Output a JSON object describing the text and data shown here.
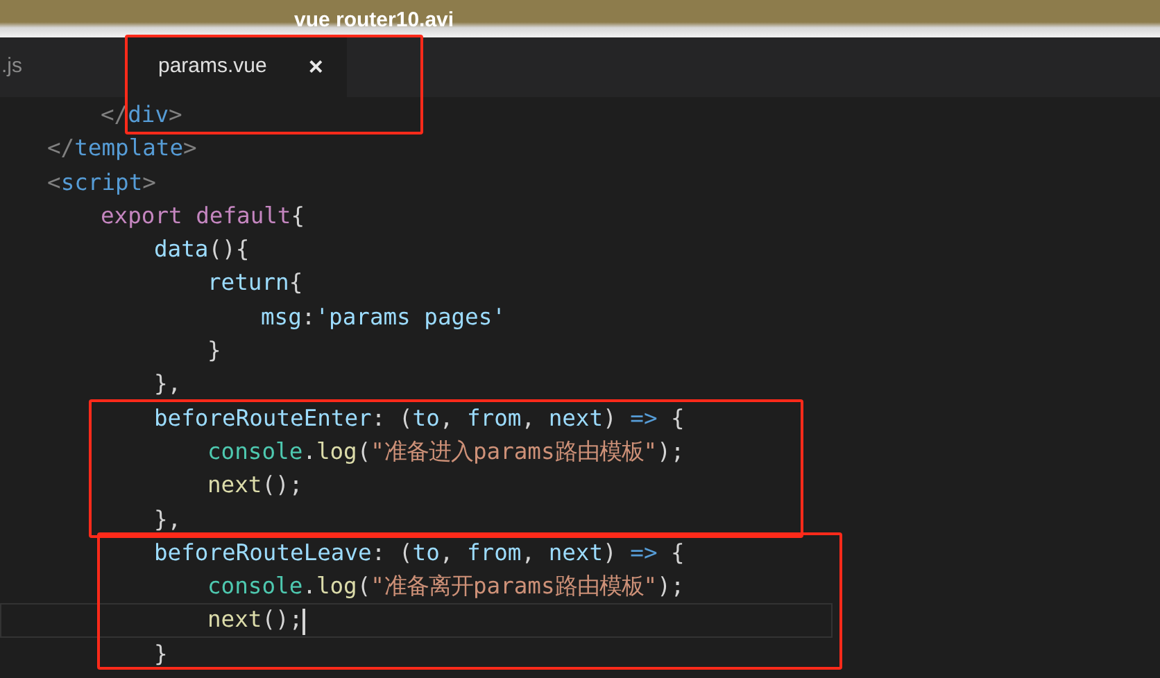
{
  "video_title": "vue router10.avi",
  "tabs": [
    {
      "label": ".js",
      "selected": false
    },
    {
      "label": "params.vue",
      "selected": true,
      "close": "×"
    }
  ],
  "code_lines": [
    {
      "children": [
        {
          "current": false,
          "tokens": [
            {
              "kind": "bracket",
              "text": "</"
            },
            {
              "kind": "tag",
              "text": "div"
            },
            {
              "kind": "bracket",
              "text": ">"
            }
          ]
        }
      ]
    },
    {
      "current": false,
      "tokens": [
        {
          "kind": "bracket",
          "text": "</"
        },
        {
          "kind": "tag",
          "text": "template"
        },
        {
          "kind": "bracket",
          "text": ">"
        }
      ]
    },
    {
      "current": false,
      "tokens": [
        {
          "kind": "bracket",
          "text": "<"
        },
        {
          "kind": "tag",
          "text": "script"
        },
        {
          "kind": "bracket",
          "text": ">"
        }
      ],
      "children": [
        {
          "current": false,
          "tokens": [
            {
              "kind": "keyword",
              "text": "export default"
            },
            {
              "kind": "punct",
              "text": "{"
            }
          ],
          "children": [
            {
              "current": false,
              "tokens": [
                {
                  "kind": "property",
                  "text": "data"
                },
                {
                  "kind": "punct",
                  "text": "(){"
                }
              ],
              "children": [
                {
                  "current": false,
                  "tokens": [
                    {
                      "kind": "property",
                      "text": "return"
                    },
                    {
                      "kind": "punct",
                      "text": "{"
                    }
                  ],
                  "children": [
                    {
                      "current": false,
                      "tokens": [
                        {
                          "kind": "property",
                          "text": "msg"
                        },
                        {
                          "kind": "punct",
                          "text": ":"
                        },
                        {
                          "kind": "property",
                          "text": "'params pages'"
                        }
                      ]
                    }
                  ]
                },
                {
                  "current": false,
                  "tokens": [
                    {
                      "kind": "punct",
                      "text": "}"
                    }
                  ]
                }
              ]
            },
            {
              "current": false,
              "tokens": [
                {
                  "kind": "punct",
                  "text": "},"
                }
              ]
            },
            {
              "current": false,
              "tokens": [
                {
                  "kind": "property",
                  "text": "beforeRouteEnter"
                },
                {
                  "kind": "punct",
                  "text": ": ("
                },
                {
                  "kind": "property",
                  "text": "to"
                },
                {
                  "kind": "punct",
                  "text": ", "
                },
                {
                  "kind": "property",
                  "text": "from"
                },
                {
                  "kind": "punct",
                  "text": ", "
                },
                {
                  "kind": "property",
                  "text": "next"
                },
                {
                  "kind": "punct",
                  "text": ") "
                },
                {
                  "kind": "arrow",
                  "text": "=>"
                },
                {
                  "kind": "punct",
                  "text": " {"
                }
              ],
              "children": [
                {
                  "current": false,
                  "tokens": [
                    {
                      "kind": "class",
                      "text": "console"
                    },
                    {
                      "kind": "punct",
                      "text": "."
                    },
                    {
                      "kind": "func",
                      "text": "log"
                    },
                    {
                      "kind": "punct",
                      "text": "("
                    },
                    {
                      "kind": "string",
                      "text": "\"准备进入params路由模板\""
                    },
                    {
                      "kind": "punct",
                      "text": ");"
                    }
                  ]
                },
                {
                  "current": false,
                  "tokens": [
                    {
                      "kind": "func",
                      "text": "next"
                    },
                    {
                      "kind": "punct",
                      "text": "();"
                    }
                  ]
                }
              ]
            },
            {
              "current": false,
              "tokens": [
                {
                  "kind": "punct",
                  "text": "},"
                }
              ]
            },
            {
              "current": false,
              "tokens": [
                {
                  "kind": "property",
                  "text": "beforeRouteLeave"
                },
                {
                  "kind": "punct",
                  "text": ": ("
                },
                {
                  "kind": "property",
                  "text": "to"
                },
                {
                  "kind": "punct",
                  "text": ", "
                },
                {
                  "kind": "property",
                  "text": "from"
                },
                {
                  "kind": "punct",
                  "text": ", "
                },
                {
                  "kind": "property",
                  "text": "next"
                },
                {
                  "kind": "punct",
                  "text": ") "
                },
                {
                  "kind": "arrow",
                  "text": "=>"
                },
                {
                  "kind": "punct",
                  "text": " {"
                }
              ],
              "children": [
                {
                  "current": false,
                  "tokens": [
                    {
                      "kind": "class",
                      "text": "console"
                    },
                    {
                      "kind": "punct",
                      "text": "."
                    },
                    {
                      "kind": "func",
                      "text": "log"
                    },
                    {
                      "kind": "punct",
                      "text": "("
                    },
                    {
                      "kind": "string",
                      "text": "\"准备离开params路由模板\""
                    },
                    {
                      "kind": "punct",
                      "text": ");"
                    }
                  ]
                },
                {
                  "current": true,
                  "tokens": [
                    {
                      "kind": "func",
                      "text": "next"
                    },
                    {
                      "kind": "punct",
                      "text": "();"
                    }
                  ]
                }
              ]
            },
            {
              "current": false,
              "tokens": [
                {
                  "kind": "punct",
                  "text": "}"
                }
              ]
            }
          ]
        }
      ]
    }
  ]
}
